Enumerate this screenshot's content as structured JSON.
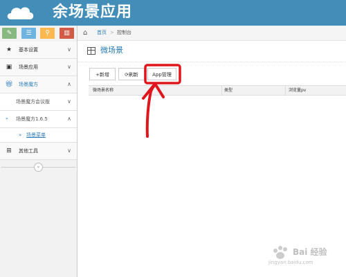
{
  "header": {
    "brand": "余场景应用"
  },
  "shortcuts": [
    {
      "icon": "pencil-icon",
      "color": "#87b87f"
    },
    {
      "icon": "list-icon",
      "color": "#6fb3e0"
    },
    {
      "icon": "search-icon",
      "color": "#ffb752"
    },
    {
      "icon": "trash-icon",
      "color": "#d15b47"
    }
  ],
  "sidebar": {
    "items": [
      {
        "label": "基本设置",
        "icon": "star-icon"
      },
      {
        "label": "场景应用",
        "icon": "briefcase-icon"
      },
      {
        "label": "场景魔方",
        "icon": "gift-icon"
      },
      {
        "label": "场景魔方会议版"
      },
      {
        "label": "场景魔方1.6.5"
      },
      {
        "label": "场景菜单"
      },
      {
        "label": "其他工具",
        "icon": "sitemap-icon"
      }
    ]
  },
  "breadcrumb": {
    "home": "首页",
    "separator": ">",
    "current": "控制台"
  },
  "page": {
    "title": "微场景"
  },
  "toolbar": {
    "add": "+新增",
    "refresh": "刷新",
    "app_manage": "App管理"
  },
  "table": {
    "columns": [
      "微场景名称",
      "类型",
      "浏览量pv"
    ]
  },
  "watermark": {
    "text": "Bai 经验",
    "url": "jingyan.baidu.com"
  },
  "colors": {
    "header": "#438eb9",
    "accent": "#2b7dbc",
    "annotation": "#e0161d"
  }
}
